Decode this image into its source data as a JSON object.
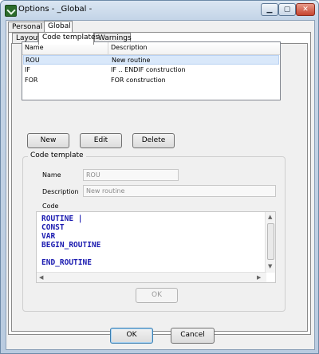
{
  "window": {
    "title": "Options - _Global -"
  },
  "top_tabs": [
    {
      "label": "Personal"
    },
    {
      "label": "Global"
    }
  ],
  "sub_tabs": [
    {
      "label": "Layout"
    },
    {
      "label": "Code templates"
    },
    {
      "label": "Warnings"
    }
  ],
  "list": {
    "headers": {
      "name": "Name",
      "description": "Description"
    },
    "rows": [
      {
        "name": "ROU",
        "description": "New routine"
      },
      {
        "name": "IF",
        "description": "IF .. ENDIF construction"
      },
      {
        "name": "FOR",
        "description": "FOR construction"
      }
    ]
  },
  "list_buttons": {
    "new": "New",
    "edit": "Edit",
    "delete": "Delete"
  },
  "code_template": {
    "legend": "Code template",
    "name_label": "Name",
    "name_value": "ROU",
    "description_label": "Description",
    "description_value": "New routine",
    "code_label": "Code",
    "code_lines": [
      "ROUTINE |",
      "CONST",
      "VAR",
      "BEGIN_ROUTINE",
      "",
      "END_ROUTINE"
    ],
    "ok_label": "OK"
  },
  "footer": {
    "ok": "OK",
    "cancel": "Cancel"
  },
  "colors": {
    "code_text": "#1b1bb0",
    "selection": "#d9e8fa",
    "titlebar": "#c3d4e7"
  }
}
